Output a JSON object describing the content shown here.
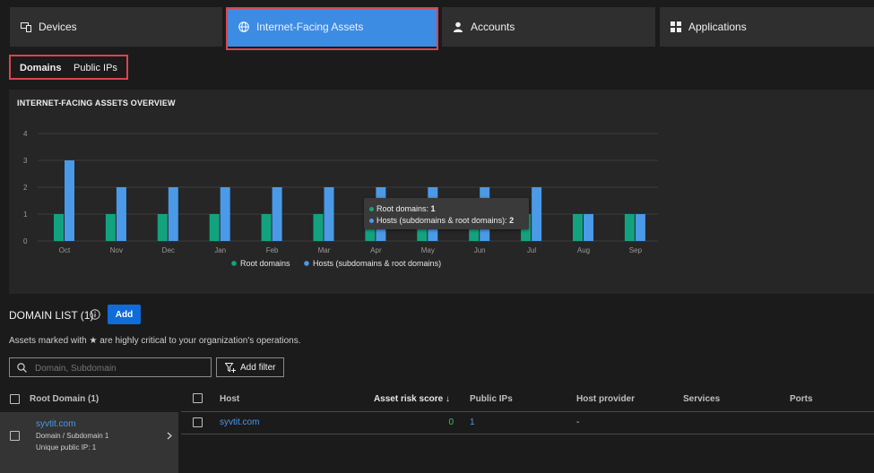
{
  "tabs": [
    {
      "label": "Devices",
      "icon": "devices-icon"
    },
    {
      "label": "Internet-Facing Assets",
      "icon": "globe-icon"
    },
    {
      "label": "Accounts",
      "icon": "user-icon"
    },
    {
      "label": "Applications",
      "icon": "apps-grid-icon"
    }
  ],
  "subtabs": [
    {
      "label": "Domains"
    },
    {
      "label": "Public IPs"
    }
  ],
  "overview": {
    "title": "INTERNET-FACING ASSETS OVERVIEW"
  },
  "chart_data": {
    "type": "bar",
    "categories": [
      "Oct",
      "Nov",
      "Dec",
      "Jan",
      "Feb",
      "Mar",
      "Apr",
      "May",
      "Jun",
      "Jul",
      "Aug",
      "Sep"
    ],
    "series": [
      {
        "name": "Root domains",
        "color": "#12a37e",
        "values": [
          1,
          1,
          1,
          1,
          1,
          1,
          1,
          1,
          1,
          1,
          1,
          1
        ]
      },
      {
        "name": "Hosts (subdomains & root domains)",
        "color": "#4a9ae8",
        "values": [
          3,
          2,
          2,
          2,
          2,
          2,
          2,
          2,
          2,
          2,
          1,
          1
        ]
      }
    ],
    "ylim": [
      0,
      4
    ],
    "yticks": [
      "0",
      "1",
      "2",
      "3",
      "4"
    ],
    "grid": true,
    "legend": "bottom",
    "tooltip": {
      "root_label": "Root domains:",
      "root_value": "1",
      "hosts_label": "Hosts (subdomains & root domains):",
      "hosts_value": "2"
    }
  },
  "domain_list": {
    "title": "DOMAIN LIST (1)",
    "add_label": "Add",
    "note_pre": "Assets marked with",
    "note_post": "are highly critical to your organization's operations.",
    "search_placeholder": "Domain, Subdomain",
    "add_filter_label": "Add filter",
    "root_header": "Root Domain (1)",
    "root_item": {
      "name": "syvtit.com",
      "type": "Domain / Subdomain 1",
      "unique": "Unique public IP: 1"
    },
    "columns": [
      "Host",
      "Asset risk score ↓",
      "Public IPs",
      "Host provider",
      "Services",
      "Ports"
    ],
    "rows": [
      {
        "host": "syvtit.com",
        "risk": "0",
        "ips": "1",
        "provider": "-"
      }
    ]
  }
}
